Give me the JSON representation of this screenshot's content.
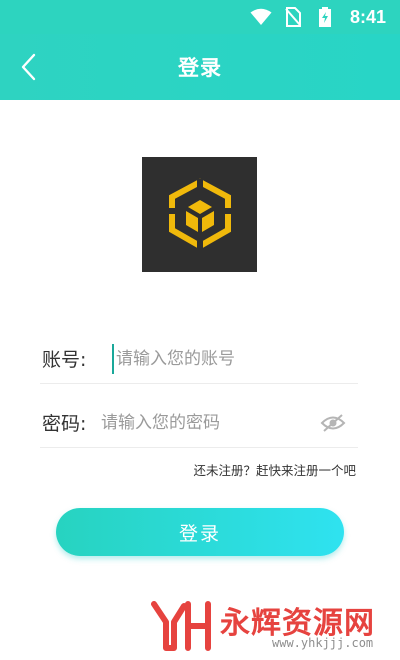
{
  "status_bar": {
    "time": "8:41",
    "icons": [
      "wifi-icon",
      "no-sim-icon",
      "battery-charging-icon"
    ]
  },
  "app_bar": {
    "title": "登录",
    "back_icon": "chevron-left-icon"
  },
  "logo": {
    "icon": "binance-cube-logo",
    "background": "#2f2f2f",
    "accent": "#f0b90b"
  },
  "form": {
    "account": {
      "label": "账号:",
      "placeholder": "请输入您的账号",
      "value": ""
    },
    "password": {
      "label": "密码:",
      "placeholder": "请输入您的密码",
      "value": "",
      "toggle_icon": "eye-off-icon"
    },
    "register_link": "还未注册？赶快来注册一个吧",
    "login_label": "登录"
  },
  "watermark": {
    "title": "永辉资源网",
    "url": "www.yhkjjj.com"
  },
  "colors": {
    "primary": "#2dd4bf",
    "button_start": "#27d3c0",
    "button_end": "#2fe2f0",
    "watermark": "#e53935"
  }
}
